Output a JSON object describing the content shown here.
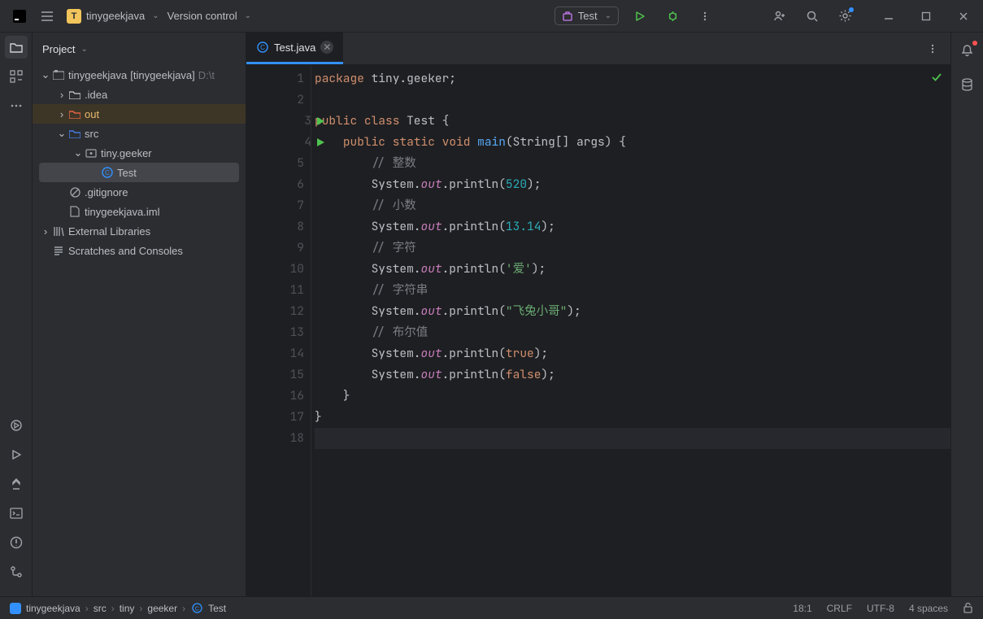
{
  "titlebar": {
    "project_name": "tinygeekjava",
    "project_badge_letter": "T",
    "vcs_label": "Version control",
    "run_config": "Test"
  },
  "sidepanel": {
    "header": "Project"
  },
  "tree": {
    "root_name": "tinygeekjava",
    "root_suffix": "[tinygeekjava]",
    "root_path": "D:\\t",
    "idea": ".idea",
    "out": "out",
    "src": "src",
    "pkg": "tiny.geeker",
    "test": "Test",
    "gitignore": ".gitignore",
    "iml": "tinygeekjava.iml",
    "external": "External Libraries",
    "scratches": "Scratches and Consoles"
  },
  "tab": {
    "filename": "Test.java"
  },
  "code": {
    "lines": [
      {
        "n": 1,
        "tokens": [
          [
            "kw",
            "package"
          ],
          [
            "plain",
            " tiny.geeker;"
          ]
        ]
      },
      {
        "n": 2,
        "tokens": []
      },
      {
        "n": 3,
        "run": true,
        "tokens": [
          [
            "kw",
            "public"
          ],
          [
            "plain",
            " "
          ],
          [
            "kw",
            "class"
          ],
          [
            "plain",
            " Test {"
          ]
        ]
      },
      {
        "n": 4,
        "run": true,
        "tokens": [
          [
            "plain",
            "    "
          ],
          [
            "kw",
            "public"
          ],
          [
            "plain",
            " "
          ],
          [
            "kw",
            "static"
          ],
          [
            "plain",
            " "
          ],
          [
            "kw",
            "void"
          ],
          [
            "plain",
            " "
          ],
          [
            "func",
            "main"
          ],
          [
            "plain",
            "(String[] args) {"
          ]
        ]
      },
      {
        "n": 5,
        "tokens": [
          [
            "plain",
            "        "
          ],
          [
            "cmt",
            "// 整数"
          ]
        ]
      },
      {
        "n": 6,
        "tokens": [
          [
            "plain",
            "        System."
          ],
          [
            "static",
            "out"
          ],
          [
            "plain",
            ".println("
          ],
          [
            "num",
            "520"
          ],
          [
            "plain",
            ");"
          ]
        ]
      },
      {
        "n": 7,
        "tokens": [
          [
            "plain",
            "        "
          ],
          [
            "cmt",
            "// 小数"
          ]
        ]
      },
      {
        "n": 8,
        "tokens": [
          [
            "plain",
            "        System."
          ],
          [
            "static",
            "out"
          ],
          [
            "plain",
            ".println("
          ],
          [
            "num",
            "13.14"
          ],
          [
            "plain",
            ");"
          ]
        ]
      },
      {
        "n": 9,
        "tokens": [
          [
            "plain",
            "        "
          ],
          [
            "cmt",
            "// 字符"
          ]
        ]
      },
      {
        "n": 10,
        "tokens": [
          [
            "plain",
            "        System."
          ],
          [
            "static",
            "out"
          ],
          [
            "plain",
            ".println("
          ],
          [
            "str",
            "'爱'"
          ],
          [
            "plain",
            ");"
          ]
        ]
      },
      {
        "n": 11,
        "tokens": [
          [
            "plain",
            "        "
          ],
          [
            "cmt",
            "// 字符串"
          ]
        ]
      },
      {
        "n": 12,
        "tokens": [
          [
            "plain",
            "        System."
          ],
          [
            "static",
            "out"
          ],
          [
            "plain",
            ".println("
          ],
          [
            "str",
            "\"飞兔小哥\""
          ],
          [
            "plain",
            ");"
          ]
        ]
      },
      {
        "n": 13,
        "tokens": [
          [
            "plain",
            "        "
          ],
          [
            "cmt",
            "// 布尔值"
          ]
        ]
      },
      {
        "n": 14,
        "tokens": [
          [
            "plain",
            "        System."
          ],
          [
            "static",
            "out"
          ],
          [
            "plain",
            ".println("
          ],
          [
            "kw",
            "true"
          ],
          [
            "plain",
            ");"
          ]
        ]
      },
      {
        "n": 15,
        "tokens": [
          [
            "plain",
            "        System."
          ],
          [
            "static",
            "out"
          ],
          [
            "plain",
            ".println("
          ],
          [
            "kw",
            "false"
          ],
          [
            "plain",
            ");"
          ]
        ]
      },
      {
        "n": 16,
        "tokens": [
          [
            "plain",
            "    }"
          ]
        ]
      },
      {
        "n": 17,
        "tokens": [
          [
            "plain",
            "}"
          ]
        ]
      },
      {
        "n": 18,
        "cursor": true,
        "tokens": []
      }
    ]
  },
  "breadcrumbs": [
    "tinygeekjava",
    "src",
    "tiny",
    "geeker",
    "Test"
  ],
  "statusbar": {
    "pos": "18:1",
    "lineend": "CRLF",
    "encoding": "UTF-8",
    "indent": "4 spaces"
  }
}
